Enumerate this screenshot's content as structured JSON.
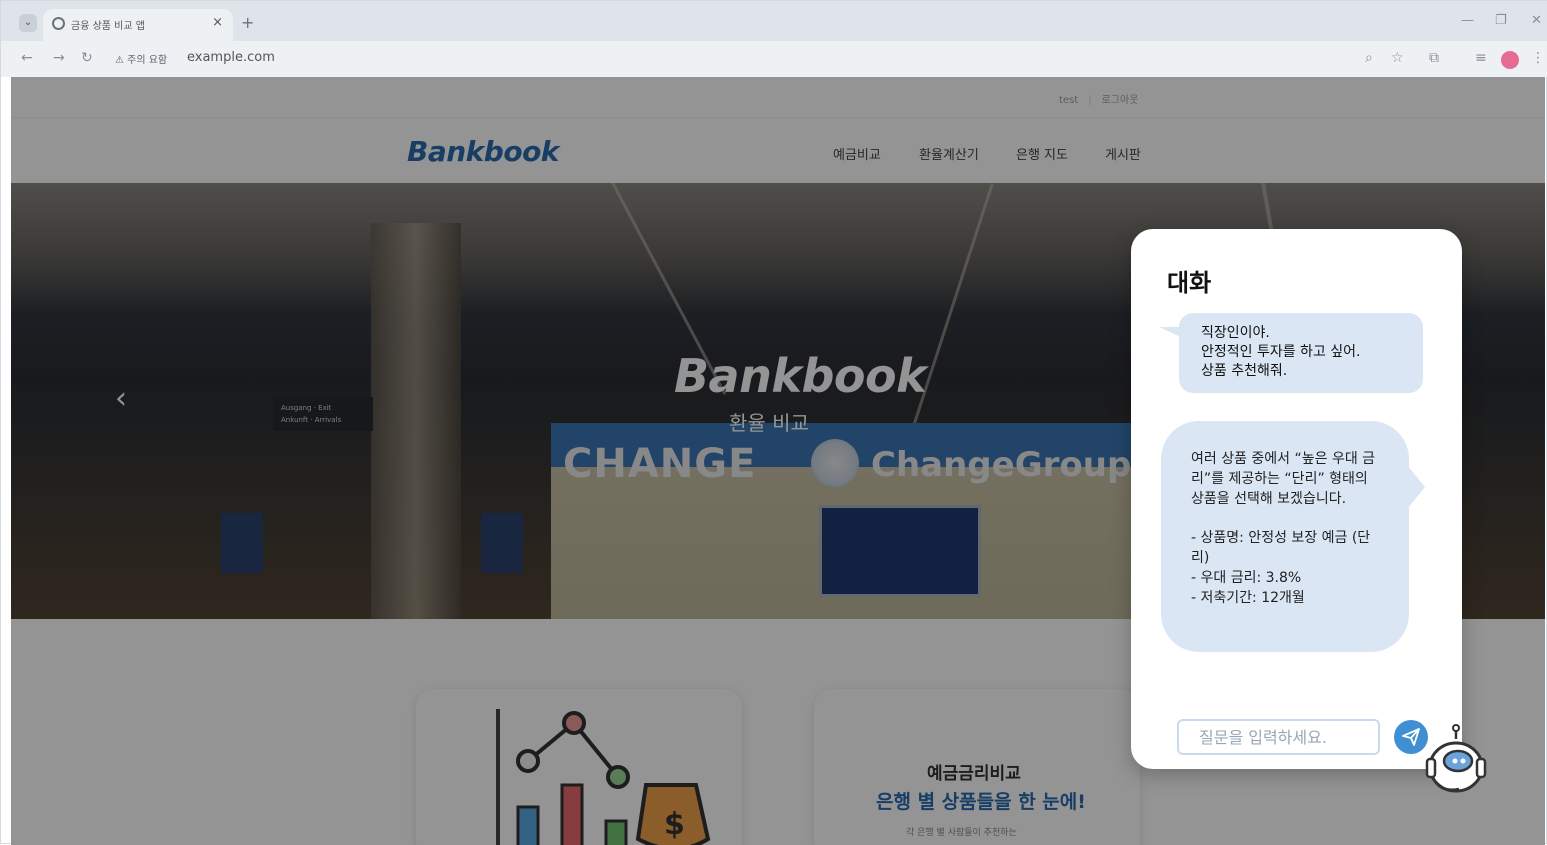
{
  "browser": {
    "tab_title": "금융 상품 비교 앱",
    "tab_close": "×",
    "new_tab": "+",
    "security_warning": "⚠ 주의 요함",
    "url": "example.com"
  },
  "header": {
    "user": "test",
    "separator": "|",
    "logout": "로그아웃",
    "logo": "Bankbook",
    "nav": [
      "예금비교",
      "환율계산기",
      "은행 지도",
      "게시판"
    ]
  },
  "hero": {
    "title": "Bankbook",
    "subtitle": "환율 비교",
    "prev_arrow": "‹",
    "sign_left": "CHANGE",
    "sign_right": "ChangeGroup",
    "exit_sign_line1": "Ausgang · Exit",
    "exit_sign_line2": "Ankunft · Arrivals"
  },
  "cards": {
    "deposit": {
      "title": "예금금리비교",
      "subtitle": "은행 별 상품들을 한 눈에!",
      "desc": "각 은행 별 사람들이 추천하는"
    }
  },
  "chat": {
    "title": "대화",
    "user_message_lines": [
      "직장인이야.",
      "안정적인 투자를 하고 싶어.",
      "상품 추천해줘."
    ],
    "bot_intro": "여러 상품 중에서 “높은 우대 금리”를 제공하는 “단리” 형태의 상품을 선택해 보겠습니다.",
    "bot_details": [
      "- 상품명: 안정성 보장 예금 (단리)",
      "- 우대 금리: 3.8%",
      "- 저축기간: 12개월"
    ],
    "input_placeholder": "질문을 입력하세요."
  },
  "colors": {
    "brand": "#2b6cb0",
    "bubble": "#dbe6f5",
    "send_button": "#3f8fd2"
  }
}
